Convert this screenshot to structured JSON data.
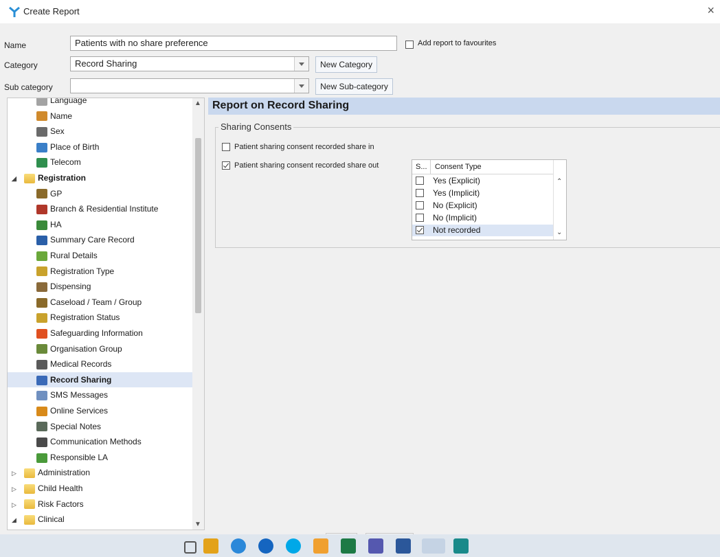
{
  "window": {
    "title": "Create Report",
    "close": "×"
  },
  "form": {
    "name_label": "Name",
    "name_value": "Patients with no share preference",
    "favourites_label": "Add report to favourites",
    "favourites_checked": false,
    "category_label": "Category",
    "category_value": "Record Sharing",
    "new_category": "New Category",
    "subcategory_label": "Sub category",
    "subcategory_value": "",
    "new_subcategory": "New Sub-category"
  },
  "tree": {
    "items": [
      {
        "label": "Language",
        "icon": "language-icon"
      },
      {
        "label": "Name",
        "icon": "name-icon"
      },
      {
        "label": "Sex",
        "icon": "sex-icon"
      },
      {
        "label": "Place of Birth",
        "icon": "globe-icon"
      },
      {
        "label": "Telecom",
        "icon": "telephone-icon"
      },
      {
        "label": "Registration",
        "icon": "folder-icon"
      },
      {
        "label": "GP",
        "icon": "person-icon"
      },
      {
        "label": "Branch & Residential Institute",
        "icon": "building-icon"
      },
      {
        "label": "HA",
        "icon": "ha-icon"
      },
      {
        "label": "Summary Care Record",
        "icon": "document-icon"
      },
      {
        "label": "Rural Details",
        "icon": "rural-icon"
      },
      {
        "label": "Registration Type",
        "icon": "form-icon"
      },
      {
        "label": "Dispensing",
        "icon": "bottle-icon"
      },
      {
        "label": "Caseload / Team / Group",
        "icon": "person-icon"
      },
      {
        "label": "Registration Status",
        "icon": "form-icon"
      },
      {
        "label": "Safeguarding Information",
        "icon": "warning-icon"
      },
      {
        "label": "Organisation Group",
        "icon": "organisation-icon"
      },
      {
        "label": "Medical Records",
        "icon": "records-icon"
      },
      {
        "label": "Record Sharing",
        "icon": "share-icon"
      },
      {
        "label": "SMS Messages",
        "icon": "phone-icon"
      },
      {
        "label": "Online Services",
        "icon": "online-icon"
      },
      {
        "label": "Special Notes",
        "icon": "notes-icon"
      },
      {
        "label": "Communication Methods",
        "icon": "pen-icon"
      },
      {
        "label": "Responsible LA",
        "icon": "la-icon"
      },
      {
        "label": "Administration",
        "icon": "folder-icon"
      },
      {
        "label": "Child Health",
        "icon": "folder-icon"
      },
      {
        "label": "Risk Factors",
        "icon": "folder-icon"
      },
      {
        "label": "Clinical",
        "icon": "folder-icon"
      }
    ]
  },
  "panel": {
    "title": "Report on Record Sharing",
    "group_title": "Sharing Consents",
    "share_in_label": "Patient sharing consent recorded share in",
    "share_in_checked": false,
    "share_out_label": "Patient sharing consent recorded share out",
    "share_out_checked": true,
    "list": {
      "col1": "S...",
      "col2": "Consent Type",
      "rows": [
        {
          "label": "Yes (Explicit)",
          "checked": false
        },
        {
          "label": "Yes (Implicit)",
          "checked": false
        },
        {
          "label": "No (Explicit)",
          "checked": false
        },
        {
          "label": "No (Implicit)",
          "checked": false
        },
        {
          "label": "Not recorded",
          "checked": true
        }
      ]
    }
  },
  "colors": {
    "accent": "#c9d8ee",
    "selection": "#dde6f5"
  }
}
